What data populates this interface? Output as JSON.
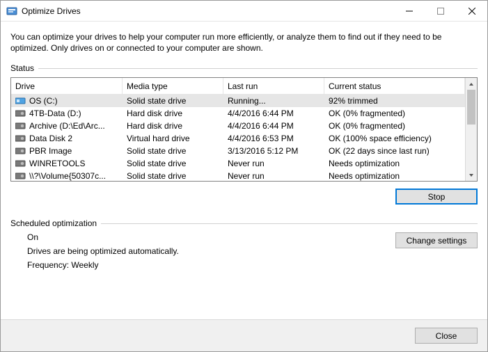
{
  "window": {
    "title": "Optimize Drives"
  },
  "intro": "You can optimize your drives to help your computer run more efficiently, or analyze them to find out if they need to be optimized. Only drives on or connected to your computer are shown.",
  "status_label": "Status",
  "columns": {
    "drive": "Drive",
    "media": "Media type",
    "last": "Last run",
    "status": "Current status"
  },
  "drives": [
    {
      "name": "OS (C:)",
      "media": "Solid state drive",
      "last": "Running...",
      "status": "92% trimmed",
      "icon": "ssd",
      "selected": true
    },
    {
      "name": "4TB-Data (D:)",
      "media": "Hard disk drive",
      "last": "4/4/2016 6:44 PM",
      "status": "OK (0% fragmented)",
      "icon": "hdd",
      "selected": false
    },
    {
      "name": "Archive (D:\\Ed\\Arc...",
      "media": "Hard disk drive",
      "last": "4/4/2016 6:44 PM",
      "status": "OK (0% fragmented)",
      "icon": "hdd",
      "selected": false
    },
    {
      "name": "Data Disk 2",
      "media": "Virtual hard drive",
      "last": "4/4/2016 6:53 PM",
      "status": "OK (100% space efficiency)",
      "icon": "hdd",
      "selected": false
    },
    {
      "name": "PBR Image",
      "media": "Solid state drive",
      "last": "3/13/2016 5:12 PM",
      "status": "OK (22 days since last run)",
      "icon": "hdd",
      "selected": false
    },
    {
      "name": "WINRETOOLS",
      "media": "Solid state drive",
      "last": "Never run",
      "status": "Needs optimization",
      "icon": "hdd",
      "selected": false
    },
    {
      "name": "\\\\?\\Volume{50307c...",
      "media": "Solid state drive",
      "last": "Never run",
      "status": "Needs optimization",
      "icon": "hdd",
      "selected": false
    }
  ],
  "buttons": {
    "stop": "Stop",
    "change_settings": "Change settings",
    "close": "Close"
  },
  "schedule": {
    "label": "Scheduled optimization",
    "state": "On",
    "desc": "Drives are being optimized automatically.",
    "freq": "Frequency: Weekly"
  }
}
